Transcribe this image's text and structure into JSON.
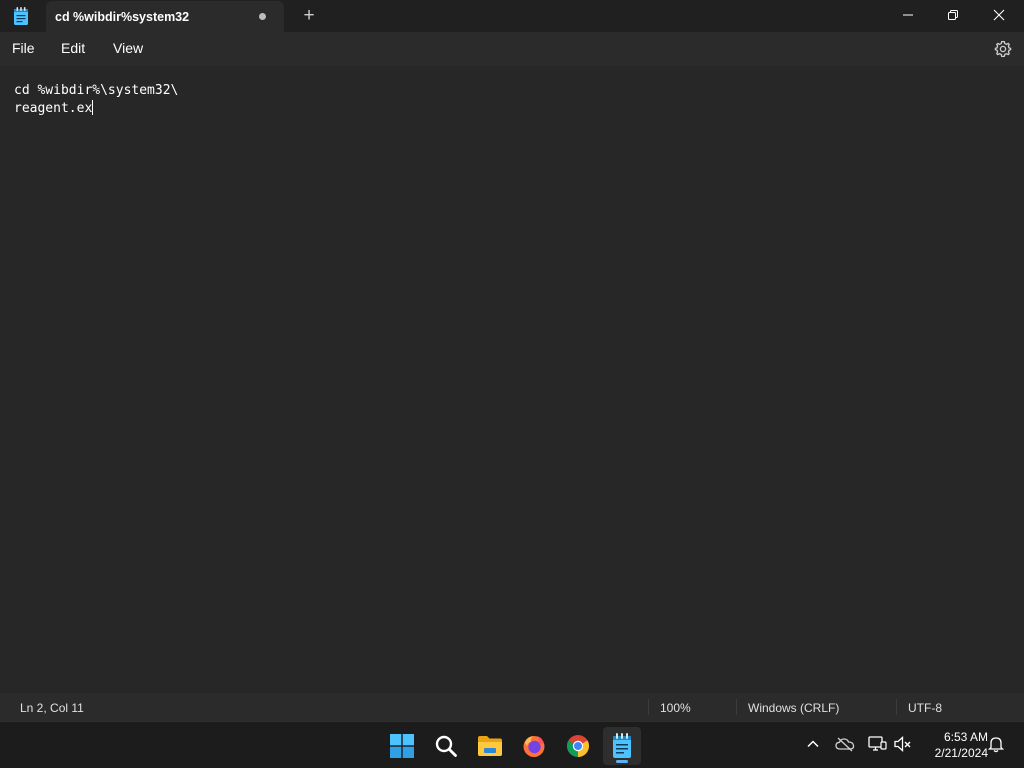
{
  "window": {
    "tab_title": "cd %wibdir%system32",
    "new_tab_label": "+",
    "app_icon": "notepad-icon",
    "controls": [
      "minimize-icon",
      "restore-icon",
      "close-icon"
    ]
  },
  "menu": {
    "file": "File",
    "edit": "Edit",
    "view": "View",
    "settings_icon": "gear-icon"
  },
  "editor": {
    "line1": "cd %wibdir%\\system32\\",
    "line2": "reagent.ex"
  },
  "status": {
    "position": "Ln 2, Col 11",
    "zoom": "100%",
    "line_ending": "Windows (CRLF)",
    "encoding": "UTF-8"
  },
  "taskbar": {
    "apps": [
      "start-icon",
      "search-icon",
      "file-explorer-icon",
      "firefox-icon",
      "chrome-icon",
      "notepad-icon"
    ],
    "active_app": "notepad-icon",
    "tray": [
      "chevron-up-icon",
      "onedrive-icon",
      "network-icon",
      "volume-muted-icon",
      "notification-bell-icon"
    ],
    "time": "6:53 AM",
    "date": "2/21/2024"
  },
  "colors": {
    "background": "#202020",
    "editor_bg": "#272727",
    "accent": "#5fb2f2"
  }
}
